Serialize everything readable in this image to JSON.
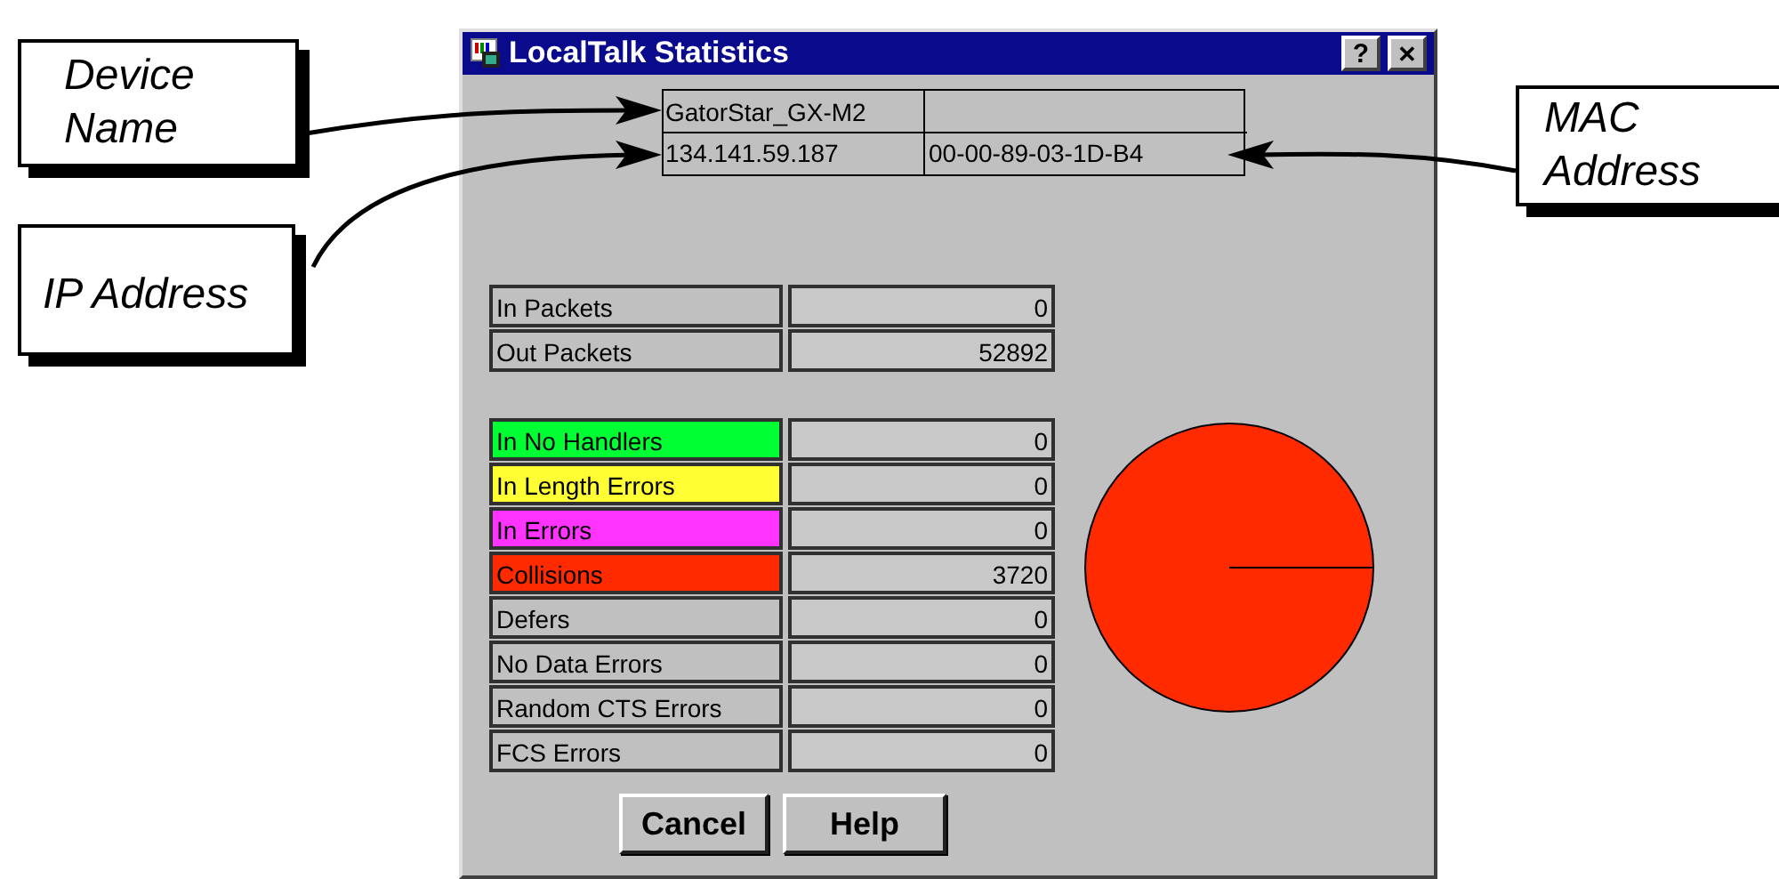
{
  "window": {
    "title": "LocalTalk Statistics",
    "help_button": "?",
    "close_button": "✕"
  },
  "device": {
    "name": "GatorStar_GX-M2",
    "ip_address": "134.141.59.187",
    "mac_address": "00-00-89-03-1D-B4"
  },
  "packets": [
    {
      "label": "In Packets",
      "value": "0"
    },
    {
      "label": "Out Packets",
      "value": "52892"
    }
  ],
  "errors": [
    {
      "label": "In No Handlers",
      "value": "0",
      "color": "#00ff33"
    },
    {
      "label": "In Length Errors",
      "value": "0",
      "color": "#ffff33"
    },
    {
      "label": "In Errors",
      "value": "0",
      "color": "#ff33ff"
    },
    {
      "label": "Collisions",
      "value": "3720",
      "color": "#ff2a00"
    },
    {
      "label": "Defers",
      "value": "0"
    },
    {
      "label": "No Data Errors",
      "value": "0"
    },
    {
      "label": "Random CTS Errors",
      "value": "0"
    },
    {
      "label": "FCS Errors",
      "value": "0"
    }
  ],
  "buttons": [
    "Cancel",
    "Help"
  ],
  "callouts": [
    {
      "text": "Device Name",
      "kind": "name"
    },
    {
      "text": "IP Address",
      "kind": "ip"
    },
    {
      "text": "MAC Address",
      "kind": "mac"
    }
  ]
}
